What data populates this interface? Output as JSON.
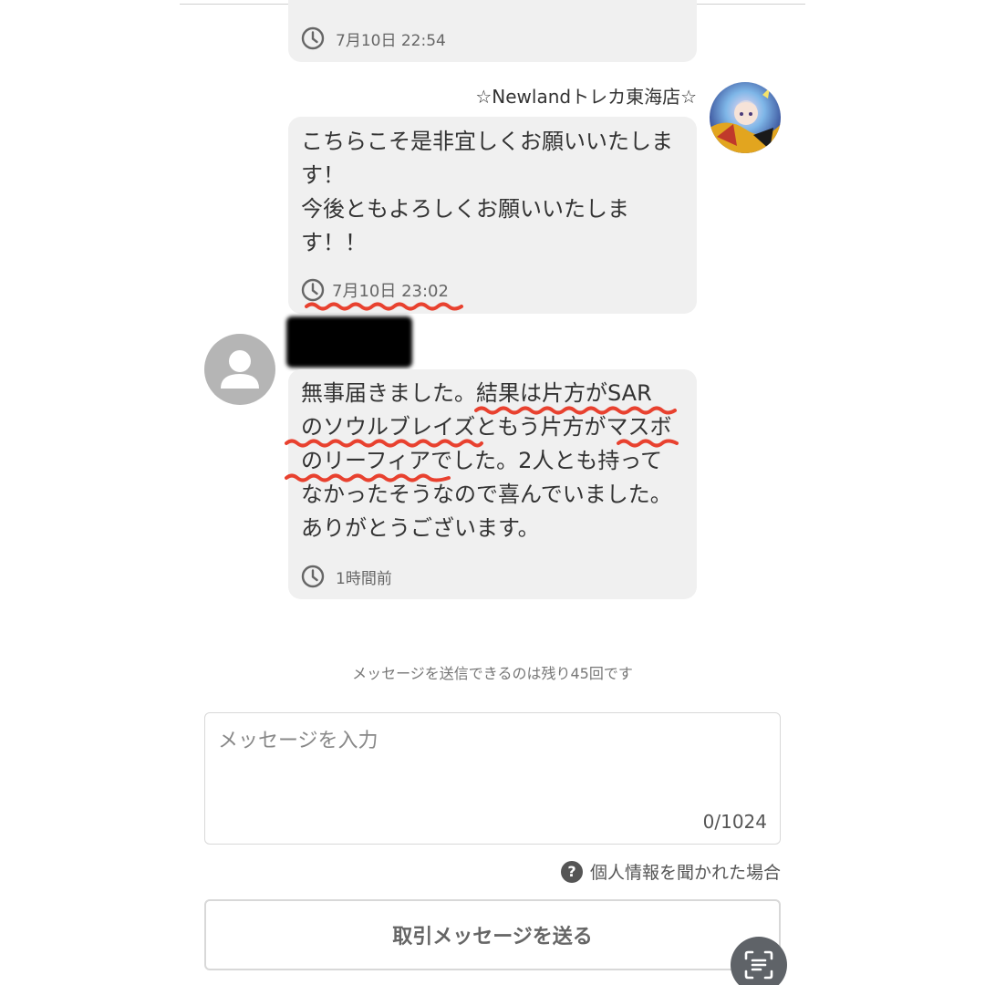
{
  "messages": [
    {
      "time": "7月10日 22:54"
    },
    {
      "sender": "☆Newlandトレカ東海店☆",
      "lines": [
        "こちらこそ是非宜しくお願いいたしま",
        "す！",
        "今後ともよろしくお願いいたしま",
        "す！！"
      ],
      "time": "7月10日 23:02"
    },
    {
      "lines": [
        "無事届きました。結果は片方がSAR",
        "のソウルブレイズともう片方がマスボ",
        "のリーフィアでした。2人とも持って",
        "なかったそうなので喜んでいました。",
        "ありがとうございます。"
      ],
      "time": "1時間前"
    }
  ],
  "remaining_note": "メッセージを送信できるのは残り45回です",
  "composer": {
    "placeholder": "メッセージを入力",
    "char_count": "0/1024"
  },
  "help_link": {
    "icon": "?",
    "label": "個人情報を聞かれた場合"
  },
  "send_button_label": "取引メッセージを送る",
  "colors": {
    "bubble": "#f0f0f0",
    "annotation_red": "#e8412f",
    "avatar_placeholder": "#b5b5b5"
  }
}
